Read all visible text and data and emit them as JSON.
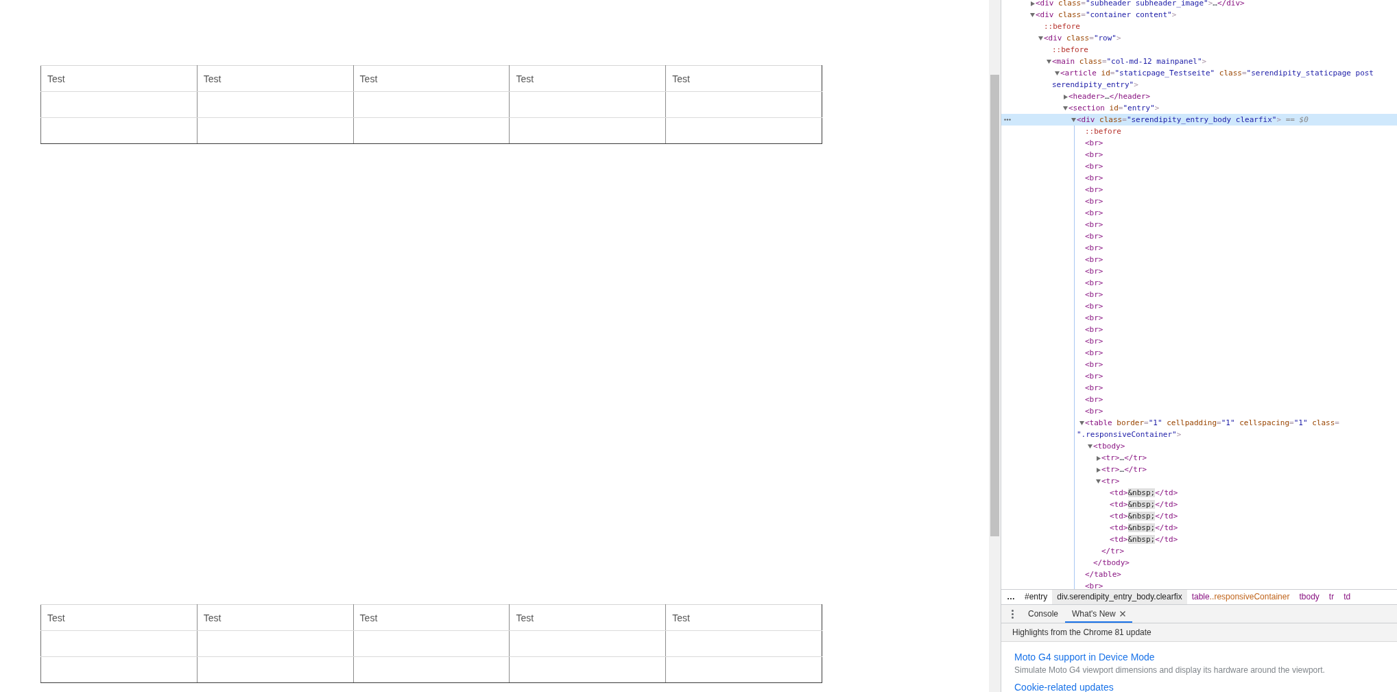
{
  "page": {
    "tables": [
      {
        "rows": [
          {
            "empty": false,
            "cells": [
              "Test",
              "Test",
              "Test",
              "Test",
              "Test"
            ]
          },
          {
            "empty": true
          },
          {
            "empty": true
          }
        ]
      },
      {
        "rows": [
          {
            "empty": false,
            "cells": [
              "Test",
              "Test",
              "Test",
              "Test",
              "Test"
            ]
          },
          {
            "empty": true
          },
          {
            "empty": true
          }
        ]
      }
    ]
  },
  "devtools": {
    "elements_tree": [
      {
        "selected": false,
        "expanded": false,
        "line": [
          {
            "kind": "tag",
            "text": "<div"
          },
          {
            "kind": "attr",
            "text": " class"
          },
          {
            "kind": "punct",
            "text": "="
          },
          {
            "kind": "value",
            "text": "\"subheader subheader_image\""
          },
          {
            "kind": "punct",
            "text": ">"
          },
          {
            "kind": "text",
            "text": "…"
          },
          {
            "kind": "tag",
            "text": "</div>"
          }
        ]
      },
      {
        "selected": false,
        "expanded": true,
        "line": [
          {
            "kind": "tag",
            "text": "<div"
          },
          {
            "kind": "attr",
            "text": " class"
          },
          {
            "kind": "punct",
            "text": "="
          },
          {
            "kind": "value",
            "text": "\"container content\""
          },
          {
            "kind": "punct",
            "text": ">"
          }
        ],
        "children": [
          {
            "selected": false,
            "line": [
              {
                "kind": "pseudo",
                "text": "::before"
              }
            ]
          },
          {
            "selected": false,
            "expanded": true,
            "line": [
              {
                "kind": "tag",
                "text": "<div"
              },
              {
                "kind": "attr",
                "text": " class"
              },
              {
                "kind": "punct",
                "text": "="
              },
              {
                "kind": "value",
                "text": "\"row\""
              },
              {
                "kind": "punct",
                "text": ">"
              }
            ],
            "children": [
              {
                "selected": false,
                "line": [
                  {
                    "kind": "pseudo",
                    "text": "::before"
                  }
                ]
              },
              {
                "selected": false,
                "expanded": true,
                "line": [
                  {
                    "kind": "tag",
                    "text": "<main"
                  },
                  {
                    "kind": "attr",
                    "text": " class"
                  },
                  {
                    "kind": "punct",
                    "text": "="
                  },
                  {
                    "kind": "value",
                    "text": "\"col-md-12 mainpanel\""
                  },
                  {
                    "kind": "punct",
                    "text": ">"
                  }
                ],
                "children": [
                  {
                    "selected": false,
                    "expanded": true,
                    "line": [
                      {
                        "kind": "tag",
                        "text": "<article"
                      },
                      {
                        "kind": "attr",
                        "text": " id"
                      },
                      {
                        "kind": "punct",
                        "text": "="
                      },
                      {
                        "kind": "value",
                        "text": "\"staticpage_Testseite\""
                      },
                      {
                        "kind": "attr",
                        "text": " class"
                      },
                      {
                        "kind": "punct",
                        "text": "="
                      },
                      {
                        "kind": "value",
                        "text": "\"serendipity_staticpage post serendipity_entry\""
                      },
                      {
                        "kind": "punct",
                        "text": ">"
                      }
                    ],
                    "children": [
                      {
                        "selected": false,
                        "expanded": false,
                        "line": [
                          {
                            "kind": "tag",
                            "text": "<header>"
                          },
                          {
                            "kind": "text",
                            "text": "…"
                          },
                          {
                            "kind": "tag",
                            "text": "</header>"
                          }
                        ]
                      },
                      {
                        "selected": false,
                        "expanded": true,
                        "line": [
                          {
                            "kind": "tag",
                            "text": "<section"
                          },
                          {
                            "kind": "attr",
                            "text": " id"
                          },
                          {
                            "kind": "punct",
                            "text": "="
                          },
                          {
                            "kind": "value",
                            "text": "\"entry\""
                          },
                          {
                            "kind": "punct",
                            "text": ">"
                          }
                        ],
                        "children": [
                          {
                            "selected": true,
                            "expanded": true,
                            "line": [
                              {
                                "kind": "tag",
                                "text": "<div"
                              },
                              {
                                "kind": "attr",
                                "text": " class"
                              },
                              {
                                "kind": "punct",
                                "text": "="
                              },
                              {
                                "kind": "value",
                                "text": "\"serendipity_entry_body clearfix\""
                              },
                              {
                                "kind": "punct",
                                "text": ">"
                              },
                              {
                                "kind": "ref",
                                "text": " == *$0*"
                              }
                            ],
                            "children": [
                              {
                                "selected": false,
                                "line": [
                                  {
                                    "kind": "pseudo",
                                    "text": "::before"
                                  }
                                ]
                              },
                              {
                                "selected": false,
                                "line": [
                                  {
                                    "kind": "tag",
                                    "text": "<br>"
                                  }
                                ]
                              },
                              {
                                "selected": false,
                                "line": [
                                  {
                                    "kind": "tag",
                                    "text": "<br>"
                                  }
                                ]
                              },
                              {
                                "selected": false,
                                "line": [
                                  {
                                    "kind": "tag",
                                    "text": "<br>"
                                  }
                                ]
                              },
                              {
                                "selected": false,
                                "line": [
                                  {
                                    "kind": "tag",
                                    "text": "<br>"
                                  }
                                ]
                              },
                              {
                                "selected": false,
                                "line": [
                                  {
                                    "kind": "tag",
                                    "text": "<br>"
                                  }
                                ]
                              },
                              {
                                "selected": false,
                                "line": [
                                  {
                                    "kind": "tag",
                                    "text": "<br>"
                                  }
                                ]
                              },
                              {
                                "selected": false,
                                "line": [
                                  {
                                    "kind": "tag",
                                    "text": "<br>"
                                  }
                                ]
                              },
                              {
                                "selected": false,
                                "line": [
                                  {
                                    "kind": "tag",
                                    "text": "<br>"
                                  }
                                ]
                              },
                              {
                                "selected": false,
                                "line": [
                                  {
                                    "kind": "tag",
                                    "text": "<br>"
                                  }
                                ]
                              },
                              {
                                "selected": false,
                                "line": [
                                  {
                                    "kind": "tag",
                                    "text": "<br>"
                                  }
                                ]
                              },
                              {
                                "selected": false,
                                "line": [
                                  {
                                    "kind": "tag",
                                    "text": "<br>"
                                  }
                                ]
                              },
                              {
                                "selected": false,
                                "line": [
                                  {
                                    "kind": "tag",
                                    "text": "<br>"
                                  }
                                ]
                              },
                              {
                                "selected": false,
                                "line": [
                                  {
                                    "kind": "tag",
                                    "text": "<br>"
                                  }
                                ]
                              },
                              {
                                "selected": false,
                                "line": [
                                  {
                                    "kind": "tag",
                                    "text": "<br>"
                                  }
                                ]
                              },
                              {
                                "selected": false,
                                "line": [
                                  {
                                    "kind": "tag",
                                    "text": "<br>"
                                  }
                                ]
                              },
                              {
                                "selected": false,
                                "line": [
                                  {
                                    "kind": "tag",
                                    "text": "<br>"
                                  }
                                ]
                              },
                              {
                                "selected": false,
                                "line": [
                                  {
                                    "kind": "tag",
                                    "text": "<br>"
                                  }
                                ]
                              },
                              {
                                "selected": false,
                                "line": [
                                  {
                                    "kind": "tag",
                                    "text": "<br>"
                                  }
                                ]
                              },
                              {
                                "selected": false,
                                "line": [
                                  {
                                    "kind": "tag",
                                    "text": "<br>"
                                  }
                                ]
                              },
                              {
                                "selected": false,
                                "line": [
                                  {
                                    "kind": "tag",
                                    "text": "<br>"
                                  }
                                ]
                              },
                              {
                                "selected": false,
                                "line": [
                                  {
                                    "kind": "tag",
                                    "text": "<br>"
                                  }
                                ]
                              },
                              {
                                "selected": false,
                                "line": [
                                  {
                                    "kind": "tag",
                                    "text": "<br>"
                                  }
                                ]
                              },
                              {
                                "selected": false,
                                "line": [
                                  {
                                    "kind": "tag",
                                    "text": "<br>"
                                  }
                                ]
                              },
                              {
                                "selected": false,
                                "line": [
                                  {
                                    "kind": "tag",
                                    "text": "<br>"
                                  }
                                ]
                              },
                              {
                                "selected": false,
                                "expanded": true,
                                "line": [
                                  {
                                    "kind": "tag",
                                    "text": "<table"
                                  },
                                  {
                                    "kind": "attr",
                                    "text": " border"
                                  },
                                  {
                                    "kind": "punct",
                                    "text": "="
                                  },
                                  {
                                    "kind": "value",
                                    "text": "\"1\""
                                  },
                                  {
                                    "kind": "attr",
                                    "text": " cellpadding"
                                  },
                                  {
                                    "kind": "punct",
                                    "text": "="
                                  },
                                  {
                                    "kind": "value",
                                    "text": "\"1\""
                                  },
                                  {
                                    "kind": "attr",
                                    "text": " cellspacing"
                                  },
                                  {
                                    "kind": "punct",
                                    "text": "="
                                  },
                                  {
                                    "kind": "value",
                                    "text": "\"1\""
                                  },
                                  {
                                    "kind": "attr",
                                    "text": " class"
                                  },
                                  {
                                    "kind": "punct",
                                    "text": "="
                                  },
                                  {
                                    "kind": "value",
                                    "text": "\".responsiveContainer\""
                                  },
                                  {
                                    "kind": "punct",
                                    "text": ">"
                                  }
                                ],
                                "children": [
                                  {
                                    "selected": false,
                                    "expanded": true,
                                    "line": [
                                      {
                                        "kind": "tag",
                                        "text": "<tbody>"
                                      }
                                    ],
                                    "children": [
                                      {
                                        "selected": false,
                                        "expanded": false,
                                        "line": [
                                          {
                                            "kind": "tag",
                                            "text": "<tr>"
                                          },
                                          {
                                            "kind": "text",
                                            "text": "…"
                                          },
                                          {
                                            "kind": "tag",
                                            "text": "</tr>"
                                          }
                                        ]
                                      },
                                      {
                                        "selected": false,
                                        "expanded": false,
                                        "line": [
                                          {
                                            "kind": "tag",
                                            "text": "<tr>"
                                          },
                                          {
                                            "kind": "text",
                                            "text": "…"
                                          },
                                          {
                                            "kind": "tag",
                                            "text": "</tr>"
                                          }
                                        ]
                                      },
                                      {
                                        "selected": false,
                                        "expanded": true,
                                        "line": [
                                          {
                                            "kind": "tag",
                                            "text": "<tr>"
                                          }
                                        ],
                                        "children": [
                                          {
                                            "selected": false,
                                            "line": [
                                              {
                                                "kind": "tag",
                                                "text": "<td>"
                                              },
                                              {
                                                "kind": "entity",
                                                "text": "&nbsp;"
                                              },
                                              {
                                                "kind": "tag",
                                                "text": "</td>"
                                              }
                                            ]
                                          },
                                          {
                                            "selected": false,
                                            "line": [
                                              {
                                                "kind": "tag",
                                                "text": "<td>"
                                              },
                                              {
                                                "kind": "entity",
                                                "text": "&nbsp;"
                                              },
                                              {
                                                "kind": "tag",
                                                "text": "</td>"
                                              }
                                            ]
                                          },
                                          {
                                            "selected": false,
                                            "line": [
                                              {
                                                "kind": "tag",
                                                "text": "<td>"
                                              },
                                              {
                                                "kind": "entity",
                                                "text": "&nbsp;"
                                              },
                                              {
                                                "kind": "tag",
                                                "text": "</td>"
                                              }
                                            ]
                                          },
                                          {
                                            "selected": false,
                                            "line": [
                                              {
                                                "kind": "tag",
                                                "text": "<td>"
                                              },
                                              {
                                                "kind": "entity",
                                                "text": "&nbsp;"
                                              },
                                              {
                                                "kind": "tag",
                                                "text": "</td>"
                                              }
                                            ]
                                          },
                                          {
                                            "selected": false,
                                            "line": [
                                              {
                                                "kind": "tag",
                                                "text": "<td>"
                                              },
                                              {
                                                "kind": "entity",
                                                "text": "&nbsp;"
                                              },
                                              {
                                                "kind": "tag",
                                                "text": "</td>"
                                              }
                                            ]
                                          }
                                        ],
                                        "closing": [
                                          {
                                            "kind": "tag",
                                            "text": "</tr>"
                                          }
                                        ]
                                      }
                                    ],
                                    "closing": [
                                      {
                                        "kind": "tag",
                                        "text": "</tbody>"
                                      }
                                    ]
                                  }
                                ],
                                "closing": [
                                  {
                                    "kind": "tag",
                                    "text": "</table>"
                                  }
                                ]
                              },
                              {
                                "selected": false,
                                "line": [
                                  {
                                    "kind": "tag",
                                    "text": "<br>"
                                  }
                                ]
                              }
                            ]
                          }
                        ]
                      }
                    ]
                  }
                ]
              }
            ]
          }
        ]
      }
    ],
    "breadcrumbs": [
      {
        "text": "…",
        "kind": "overflow",
        "selected": false
      },
      {
        "text": "#entry",
        "kind": "ancestor",
        "selected": false
      },
      {
        "text": "div.serendipity_entry_body.clearfix",
        "kind": "ancestor",
        "selected": true
      },
      {
        "text": "table",
        "suffix": "..responsiveContainer",
        "kind": "descendant",
        "selected": false
      },
      {
        "text": "tbody",
        "kind": "descendant",
        "selected": false
      },
      {
        "text": "tr",
        "kind": "descendant",
        "selected": false
      },
      {
        "text": "td",
        "kind": "descendant",
        "selected": false
      }
    ],
    "drawer": {
      "tabs": [
        {
          "label": "Console",
          "selected": false,
          "closable": false
        },
        {
          "label": "What's New",
          "selected": true,
          "closable": true
        }
      ],
      "heading": "Highlights from the Chrome 81 update",
      "items": [
        {
          "title": "Moto G4 support in Device Mode",
          "description": "Simulate Moto G4 viewport dimensions and display its hardware around the viewport."
        },
        {
          "title": "Cookie-related updates"
        }
      ]
    }
  }
}
